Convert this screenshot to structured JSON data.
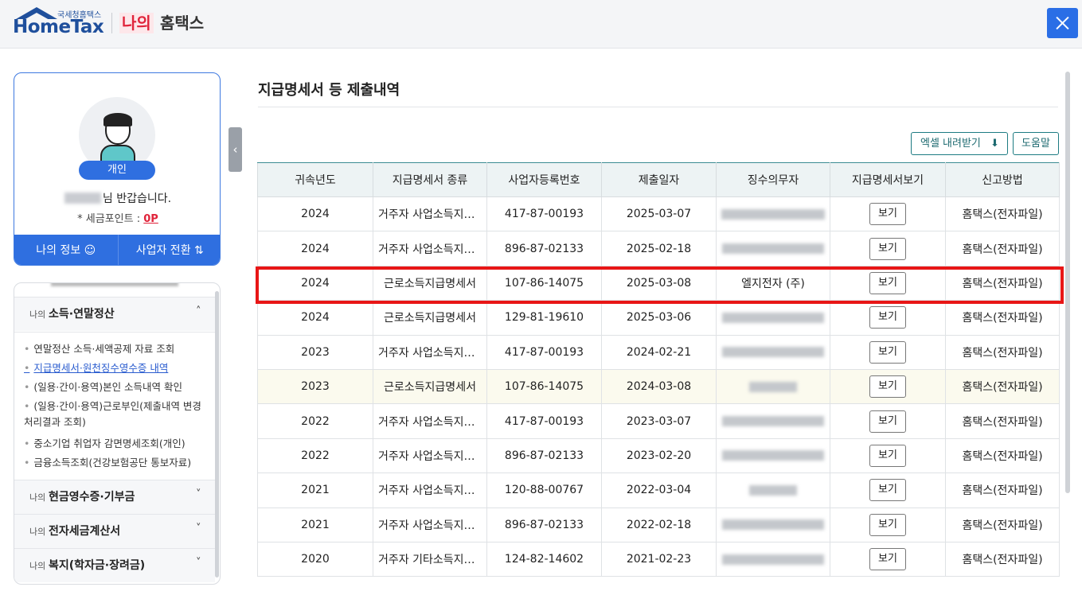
{
  "header": {
    "logo_sub": "국세청홈택스",
    "logo_main": "HomeTax",
    "my_label": "나의",
    "hometax_label": "홈택스",
    "close_icon": "close-icon"
  },
  "profile": {
    "badge": "개인",
    "greeting_suffix": "님 반갑습니다.",
    "points_label": "* 세금포인트 : ",
    "points_value": "0P",
    "my_info_button": "나의 정보 ",
    "business_switch_button": "사업자 전환 "
  },
  "menu": {
    "sections": [
      {
        "prefix": "나의",
        "title": "소득·연말정산",
        "chevron": "˄"
      },
      {
        "prefix": "나의",
        "title": "현금영수증·기부금",
        "chevron": "˅"
      },
      {
        "prefix": "나의",
        "title": "전자세금계산서",
        "chevron": "˅"
      },
      {
        "prefix": "나의",
        "title": "복지(학자금·장려금)",
        "chevron": "˅"
      }
    ],
    "items": [
      "연말정산 소득·세액공제 자료 조회",
      "지급명세서·원천징수영수증 내역",
      "(일용·간이·용역)본인 소득내역 확인",
      "(일용·간이·용역)근로부인(제출내역 변경 처리결과 조회)",
      "중소기업 취업자 감면명세조회(개인)",
      "금융소득조회(건강보험공단 통보자료)"
    ]
  },
  "main": {
    "title": "지급명세서 등 제출내역",
    "excel_button": "엑셀 내려받기",
    "help_button": "도움말",
    "columns": [
      "귀속년도",
      "지급명세서 종류",
      "사업자등록번호",
      "제출일자",
      "징수의무자",
      "지급명세서보기",
      "신고방법"
    ],
    "view_label": "보기",
    "rows": [
      [
        "2024",
        "거주자 사업소득지급명세서",
        "417-87-00193",
        "2025-03-07",
        "",
        "홈택스(전자파일)"
      ],
      [
        "2024",
        "거주자 사업소득지급명세서",
        "896-87-02133",
        "2025-02-18",
        "",
        "홈택스(전자파일)"
      ],
      [
        "2024",
        "근로소득지급명세서",
        "107-86-14075",
        "2025-03-08",
        "엘지전자 (주)",
        "홈택스(전자파일)"
      ],
      [
        "2024",
        "근로소득지급명세서",
        "129-81-19610",
        "2025-03-06",
        "",
        "홈택스(전자파일)"
      ],
      [
        "2023",
        "거주자 사업소득지급명세서",
        "417-87-00193",
        "2024-02-21",
        "",
        "홈택스(전자파일)"
      ],
      [
        "2023",
        "근로소득지급명세서",
        "107-86-14075",
        "2024-03-08",
        "",
        "홈택스(전자파일)"
      ],
      [
        "2022",
        "거주자 사업소득지급명세서",
        "417-87-00193",
        "2023-03-07",
        "",
        "홈택스(전자파일)"
      ],
      [
        "2022",
        "거주자 사업소득지급명세서",
        "896-87-02133",
        "2023-02-20",
        "",
        "홈택스(전자파일)"
      ],
      [
        "2021",
        "거주자 사업소득지급명세서",
        "120-88-00767",
        "2022-03-04",
        "",
        "홈택스(전자파일)"
      ],
      [
        "2021",
        "거주자 사업소득지급명세서",
        "896-87-02133",
        "2022-02-18",
        "",
        "홈택스(전자파일)"
      ],
      [
        "2020",
        "거주자 기타소득지급명세서",
        "124-82-14602",
        "2021-02-23",
        "",
        "홈택스(전자파일)"
      ]
    ]
  }
}
